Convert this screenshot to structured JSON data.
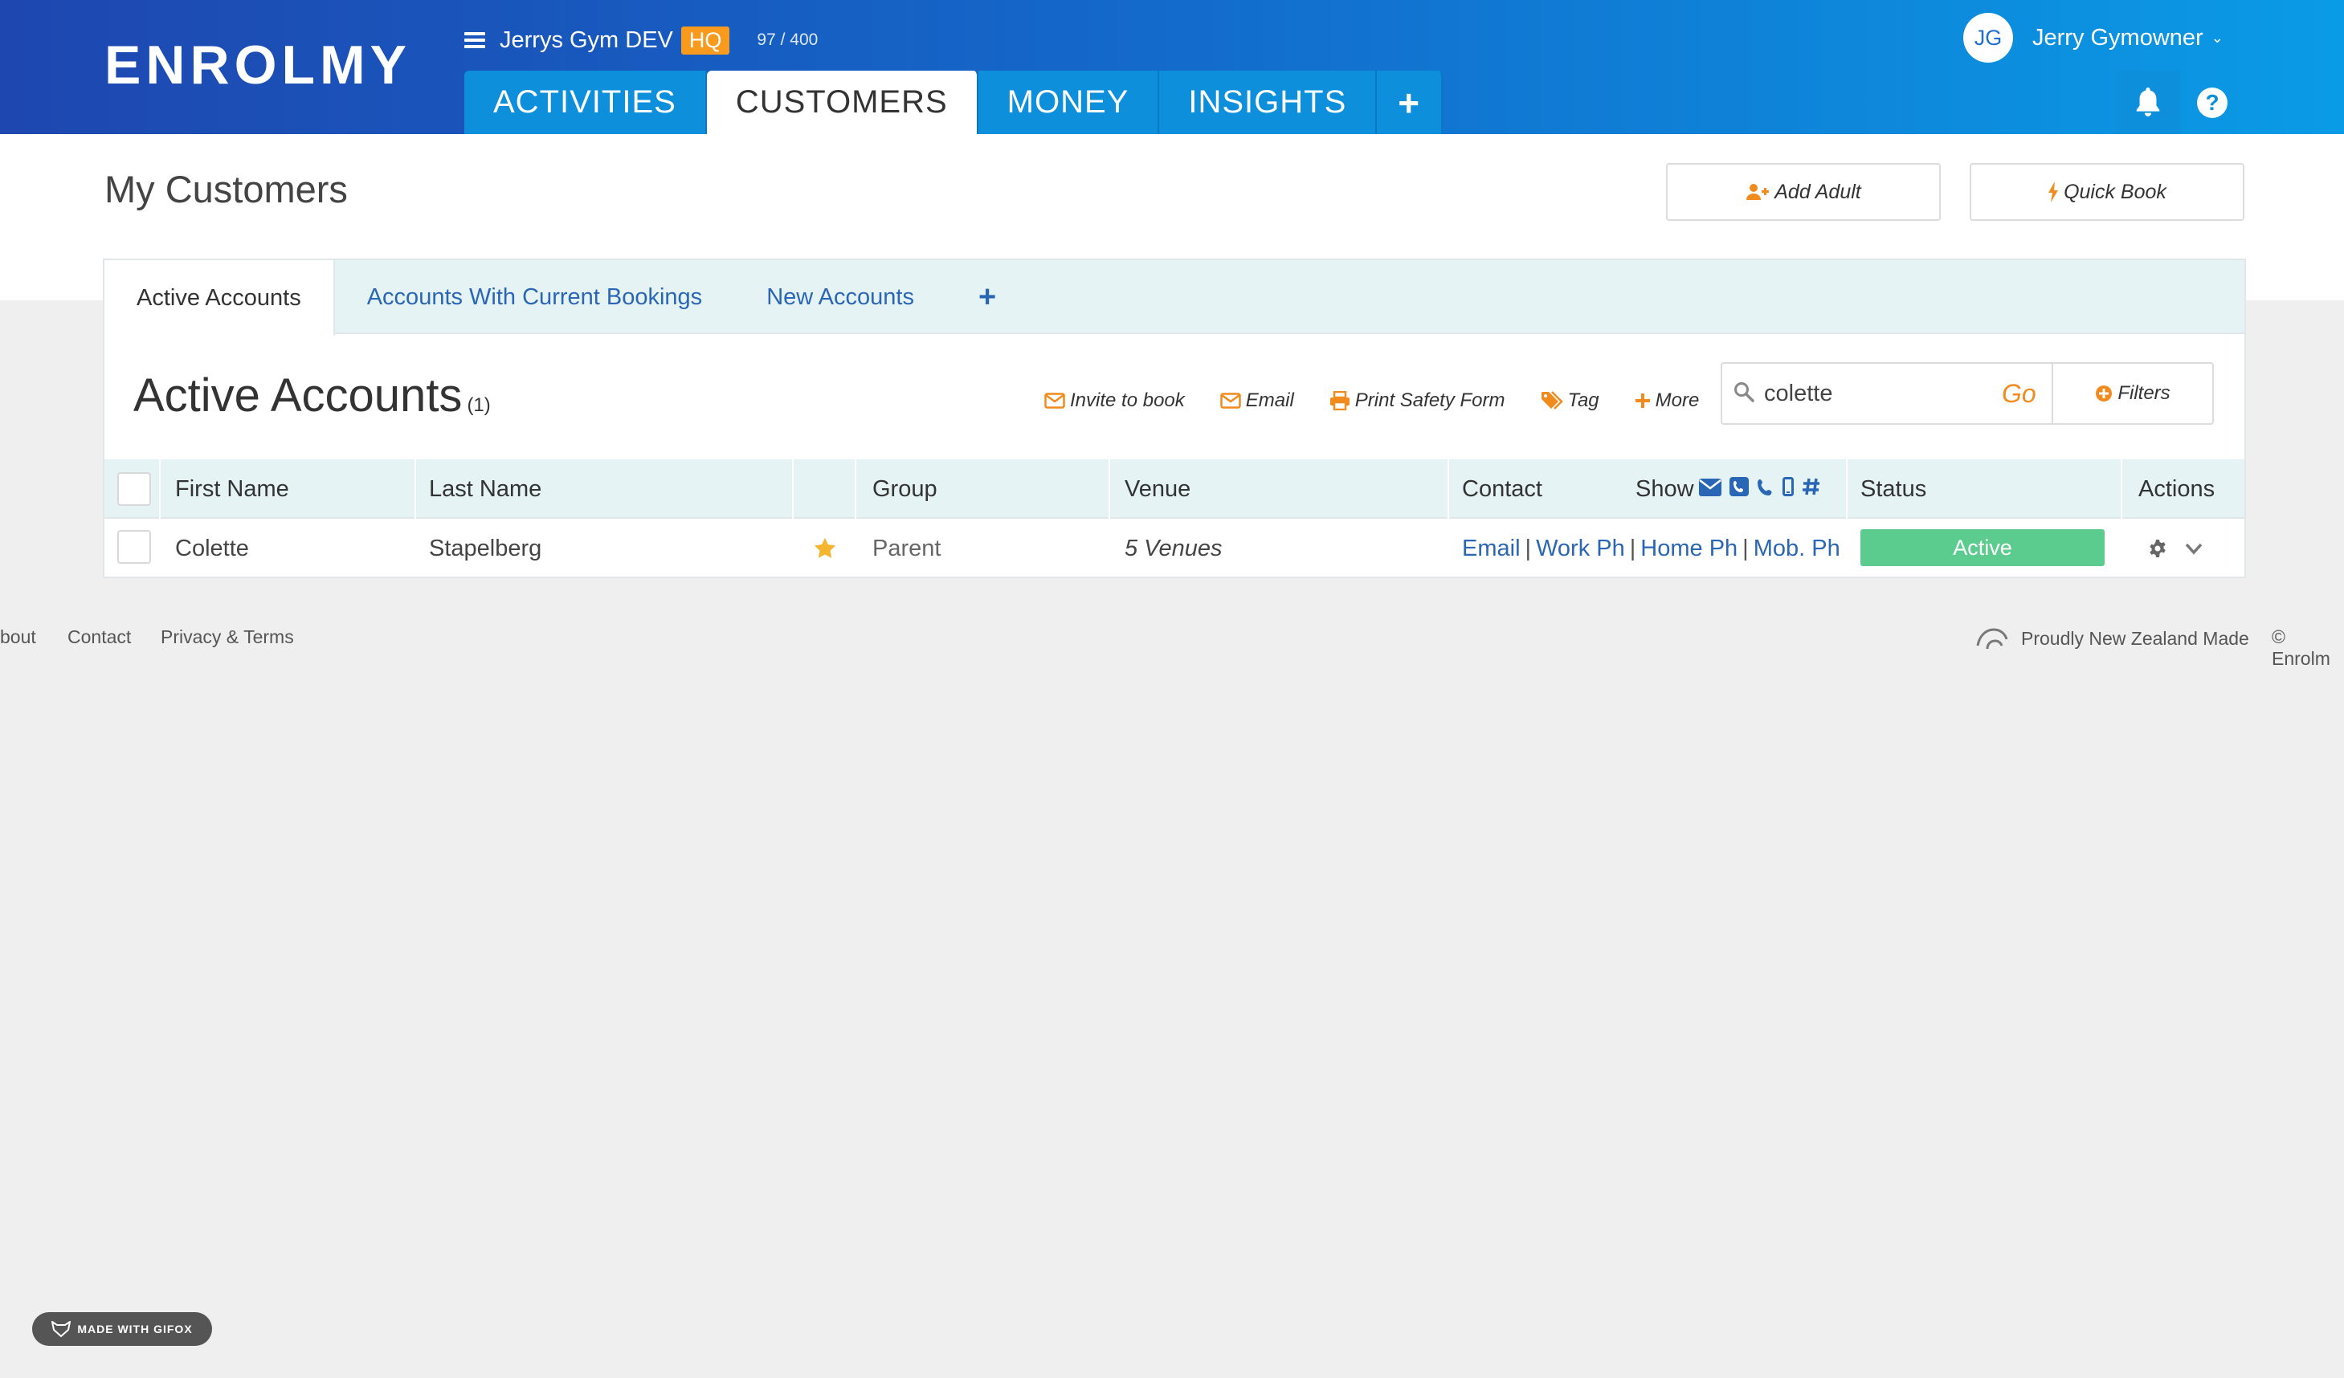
{
  "header": {
    "logo": "ENROLMY",
    "org_name": "Jerrys Gym DEV",
    "hq_badge": "HQ",
    "count": "97 / 400",
    "tabs": [
      {
        "label": "ACTIVITIES"
      },
      {
        "label": "CUSTOMERS",
        "active": true
      },
      {
        "label": "MONEY"
      },
      {
        "label": "INSIGHTS"
      },
      {
        "label": "+"
      }
    ],
    "user": {
      "initials": "JG",
      "name": "Jerry Gymowner"
    },
    "icons": [
      "bell-icon",
      "help-icon"
    ]
  },
  "page": {
    "title": "My Customers",
    "buttons": {
      "add_adult": "Add Adult",
      "quick_book": "Quick Book"
    }
  },
  "subtabs": [
    {
      "label": "Active Accounts",
      "active": true
    },
    {
      "label": "Accounts With Current Bookings"
    },
    {
      "label": "New Accounts"
    },
    {
      "label": "+"
    }
  ],
  "list": {
    "title": "Active Accounts",
    "count": "(1)",
    "actions": {
      "invite": "Invite to book",
      "email": "Email",
      "print": "Print Safety Form",
      "tag": "Tag",
      "more": "More"
    },
    "search": {
      "value": "colette",
      "go": "Go"
    },
    "filters": "Filters"
  },
  "table": {
    "columns": {
      "first_name": "First Name",
      "last_name": "Last Name",
      "group": "Group",
      "venue": "Venue",
      "contact": "Contact",
      "show": "Show",
      "status": "Status",
      "actions": "Actions"
    },
    "rows": [
      {
        "first_name": "Colette",
        "last_name": "Stapelberg",
        "starred": true,
        "group": "Parent",
        "venue": "5 Venues",
        "contact": {
          "email": "Email",
          "work": "Work Ph",
          "home": "Home Ph",
          "mobile": "Mob. Ph"
        },
        "status": "Active"
      }
    ]
  },
  "footer": {
    "about": "bout",
    "contact": "Contact",
    "privacy": "Privacy & Terms",
    "made_in": "Proudly New Zealand Made",
    "copyright": "© Enrolm"
  },
  "watermark": "MADE WITH GIFOX",
  "colors": {
    "header_start": "#1e47b0",
    "header_end": "#0a9be6",
    "tab_blue": "#0d8fdc",
    "accent_orange": "#f18b1e",
    "link_blue": "#2a66b6",
    "status_green": "#5ccc8e"
  }
}
